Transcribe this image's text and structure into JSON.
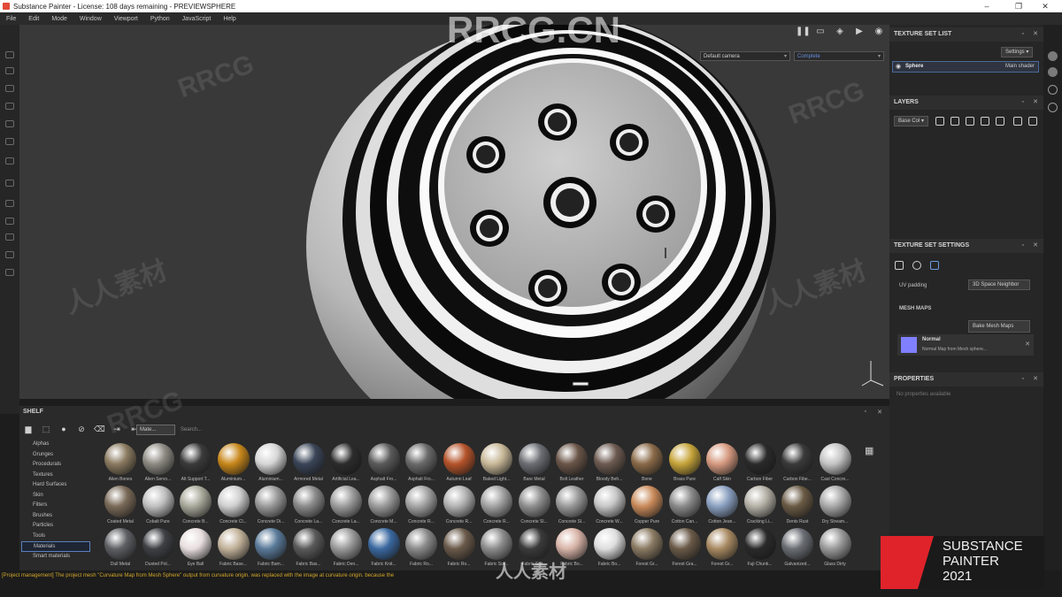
{
  "window": {
    "title": "Substance Painter - License: 108 days remaining - PREVIEWSPHERE"
  },
  "menu": [
    "File",
    "Edit",
    "Mode",
    "Window",
    "Viewport",
    "Python",
    "JavaScript",
    "Help"
  ],
  "viewport": {
    "camera": "Default camera",
    "mode": "Complete"
  },
  "texture_set_list": {
    "title": "TEXTURE SET LIST",
    "settings": "Settings",
    "item": "Sphere",
    "shader": "Main shader"
  },
  "layers": {
    "title": "LAYERS",
    "channel": "Base Col"
  },
  "texture_set_settings": {
    "title": "TEXTURE SET SETTINGS",
    "uv_padding_label": "UV padding",
    "uv_padding_value": "3D Space Neighbor",
    "mesh_maps": "MESH MAPS",
    "bake_button": "Bake Mesh Maps",
    "normal_title": "Normal",
    "normal_desc": "Normal Map from Mesh sphere..."
  },
  "properties": {
    "title": "PROPERTIES",
    "empty": "No properties available"
  },
  "shelf": {
    "title": "SHELF",
    "search_filter": "Mate...",
    "search_placeholder": "Search...",
    "categories": [
      "Alphas",
      "Grunges",
      "Procedurals",
      "Textures",
      "Hard Surfaces",
      "Skin",
      "Filters",
      "Brushes",
      "Particles",
      "Tools",
      "Materials",
      "Smart materials"
    ],
    "selected_category": "Materials",
    "row1": [
      {
        "n": "Alien Bones",
        "c": "#8a7a60"
      },
      {
        "n": "Alien Servo...",
        "c": "#8c8a82"
      },
      {
        "n": "Alt Support T...",
        "c": "#3a3a3a"
      },
      {
        "n": "Aluminium...",
        "c": "#c8871a"
      },
      {
        "n": "Aluminium...",
        "c": "#d6d6d6"
      },
      {
        "n": "Armored Metal",
        "c": "#3a4558"
      },
      {
        "n": "Artificial Lea...",
        "c": "#2c2c2c"
      },
      {
        "n": "Asphalt Fro...",
        "c": "#5a5a5a"
      },
      {
        "n": "Asphalt Fro...",
        "c": "#6a6a6a"
      },
      {
        "n": "Autumn Leaf",
        "c": "#b5532a"
      },
      {
        "n": "Baked Light...",
        "c": "#c8b898"
      },
      {
        "n": "Bare Metal",
        "c": "#6c6e74"
      },
      {
        "n": "Bolt Leather",
        "c": "#6a5548"
      },
      {
        "n": "Bloody Beh...",
        "c": "#6c5a50"
      },
      {
        "n": "Bone",
        "c": "#8a6a48"
      },
      {
        "n": "Brass Pure",
        "c": "#c6a43a"
      },
      {
        "n": "Calf Skin",
        "c": "#d69a80"
      },
      {
        "n": "Carbon Fiber",
        "c": "#2a2a2a"
      },
      {
        "n": "Carbon Fibe...",
        "c": "#3a3a3a"
      },
      {
        "n": "Cast Concre...",
        "c": "#c4c4c4"
      }
    ],
    "row2": [
      {
        "n": "Coated Metal",
        "c": "#7a6a58"
      },
      {
        "n": "Cobalt Pure",
        "c": "#c0c0c0"
      },
      {
        "n": "Concrete B...",
        "c": "#a8a89a"
      },
      {
        "n": "Concrete Cl...",
        "c": "#cfcfcf"
      },
      {
        "n": "Concrete Di...",
        "c": "#9a9a9a"
      },
      {
        "n": "Concrete La...",
        "c": "#8a8a8a"
      },
      {
        "n": "Concrete La...",
        "c": "#9c9c9c"
      },
      {
        "n": "Concrete M...",
        "c": "#9a9a9a"
      },
      {
        "n": "Concrete R...",
        "c": "#a4a4a4"
      },
      {
        "n": "Concrete R...",
        "c": "#b2b2b2"
      },
      {
        "n": "Concrete R...",
        "c": "#a2a2a2"
      },
      {
        "n": "Concrete Sl...",
        "c": "#8e8e8e"
      },
      {
        "n": "Concrete Sl...",
        "c": "#9a9a9a"
      },
      {
        "n": "Concrete W...",
        "c": "#c6c6c6"
      },
      {
        "n": "Copper Pure",
        "c": "#c98a5a"
      },
      {
        "n": "Cotton Can...",
        "c": "#8a8a8a"
      },
      {
        "n": "Cotton Jean...",
        "c": "#8aa0c0"
      },
      {
        "n": "Cracking Li...",
        "c": "#b4b0a6"
      },
      {
        "n": "Dents Rust",
        "c": "#6a5a44"
      },
      {
        "n": "Dry Stream...",
        "c": "#a8a8a8"
      }
    ],
    "row3": [
      {
        "n": "Dull Metal",
        "c": "#5e6064"
      },
      {
        "n": "Dusted Pol...",
        "c": "#3e4044"
      },
      {
        "n": "Eye Ball",
        "c": "#e8dede"
      },
      {
        "n": "Fabric Base...",
        "c": "#c2b29a"
      },
      {
        "n": "Fabric Bam...",
        "c": "#5a7a9a"
      },
      {
        "n": "Fabric Bas...",
        "c": "#5a5a5a"
      },
      {
        "n": "Fabric Den...",
        "c": "#9a9a9a"
      },
      {
        "n": "Fabric Knit...",
        "c": "#3a68a0"
      },
      {
        "n": "Fabric Ro...",
        "c": "#8a8a8a"
      },
      {
        "n": "Fabric Ro...",
        "c": "#6a5a4a"
      },
      {
        "n": "Fabric Sof...",
        "c": "#8c8c8c"
      },
      {
        "n": "Fabric Suit...",
        "c": "#3a3a3a"
      },
      {
        "n": "Fabric Bo...",
        "c": "#d8b4a8"
      },
      {
        "n": "Fabric Bo...",
        "c": "#dedede"
      },
      {
        "n": "Forest Gr...",
        "c": "#8a7a62"
      },
      {
        "n": "Forest Gra...",
        "c": "#6a5a48"
      },
      {
        "n": "Forest Gr...",
        "c": "#a88a62"
      },
      {
        "n": "Fuji Chunk...",
        "c": "#2a2a2a"
      },
      {
        "n": "Galvanized...",
        "c": "#6a6e74"
      },
      {
        "n": "Glass Dirty",
        "c": "#9a9a9a"
      }
    ]
  },
  "status": {
    "message": "[Project management] The project mesh \"Curvature Map from Mesh Sphere\" output from curvature origin. was replaced with the image at curvature origin. because the"
  },
  "badge": {
    "line1": "SUBSTANCE",
    "line2": "PAINTER",
    "line3": "2021"
  },
  "watermark": {
    "text": "RRCG.CN",
    "cn": "人人素材",
    "short": "RRCG"
  }
}
